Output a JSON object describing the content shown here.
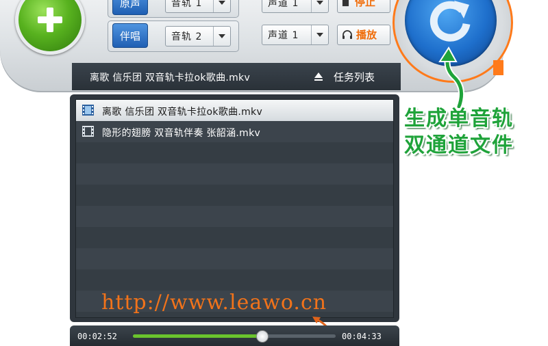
{
  "toolbar": {
    "group1": {
      "tag": "原声",
      "track": "音轨 1",
      "channel": "声道 1",
      "action": "停止"
    },
    "group2": {
      "tag": "伴唱",
      "track": "音轨 2",
      "channel": "声道 1",
      "action": "播放"
    }
  },
  "title_bar": {
    "current_file": "离歌 信乐团 双音轨卡拉ok歌曲.mkv",
    "task_list": "任务列表"
  },
  "file_list": [
    {
      "name": "离歌 信乐团 双音轨卡拉ok歌曲.mkv",
      "selected": true
    },
    {
      "name": "隐形的翅膀 双音轨伴奏 张韶涵.mkv",
      "selected": false
    }
  ],
  "watermark": "http://www.leawo.cn",
  "player": {
    "elapsed": "00:02:52",
    "total": "00:04:33",
    "progress": 0.634
  },
  "annotation": {
    "line1": "生成单音轨",
    "line2": "双通道文件"
  },
  "colors": {
    "accent_orange": "#f06d0a",
    "annotation_green": "#1fa33a",
    "progress_green": "#6ac32d"
  },
  "icons": [
    "plus-icon",
    "refresh-icon",
    "dropdown-arrow-icon",
    "stop-icon",
    "headphones-icon",
    "eject-icon",
    "film-icon"
  ]
}
